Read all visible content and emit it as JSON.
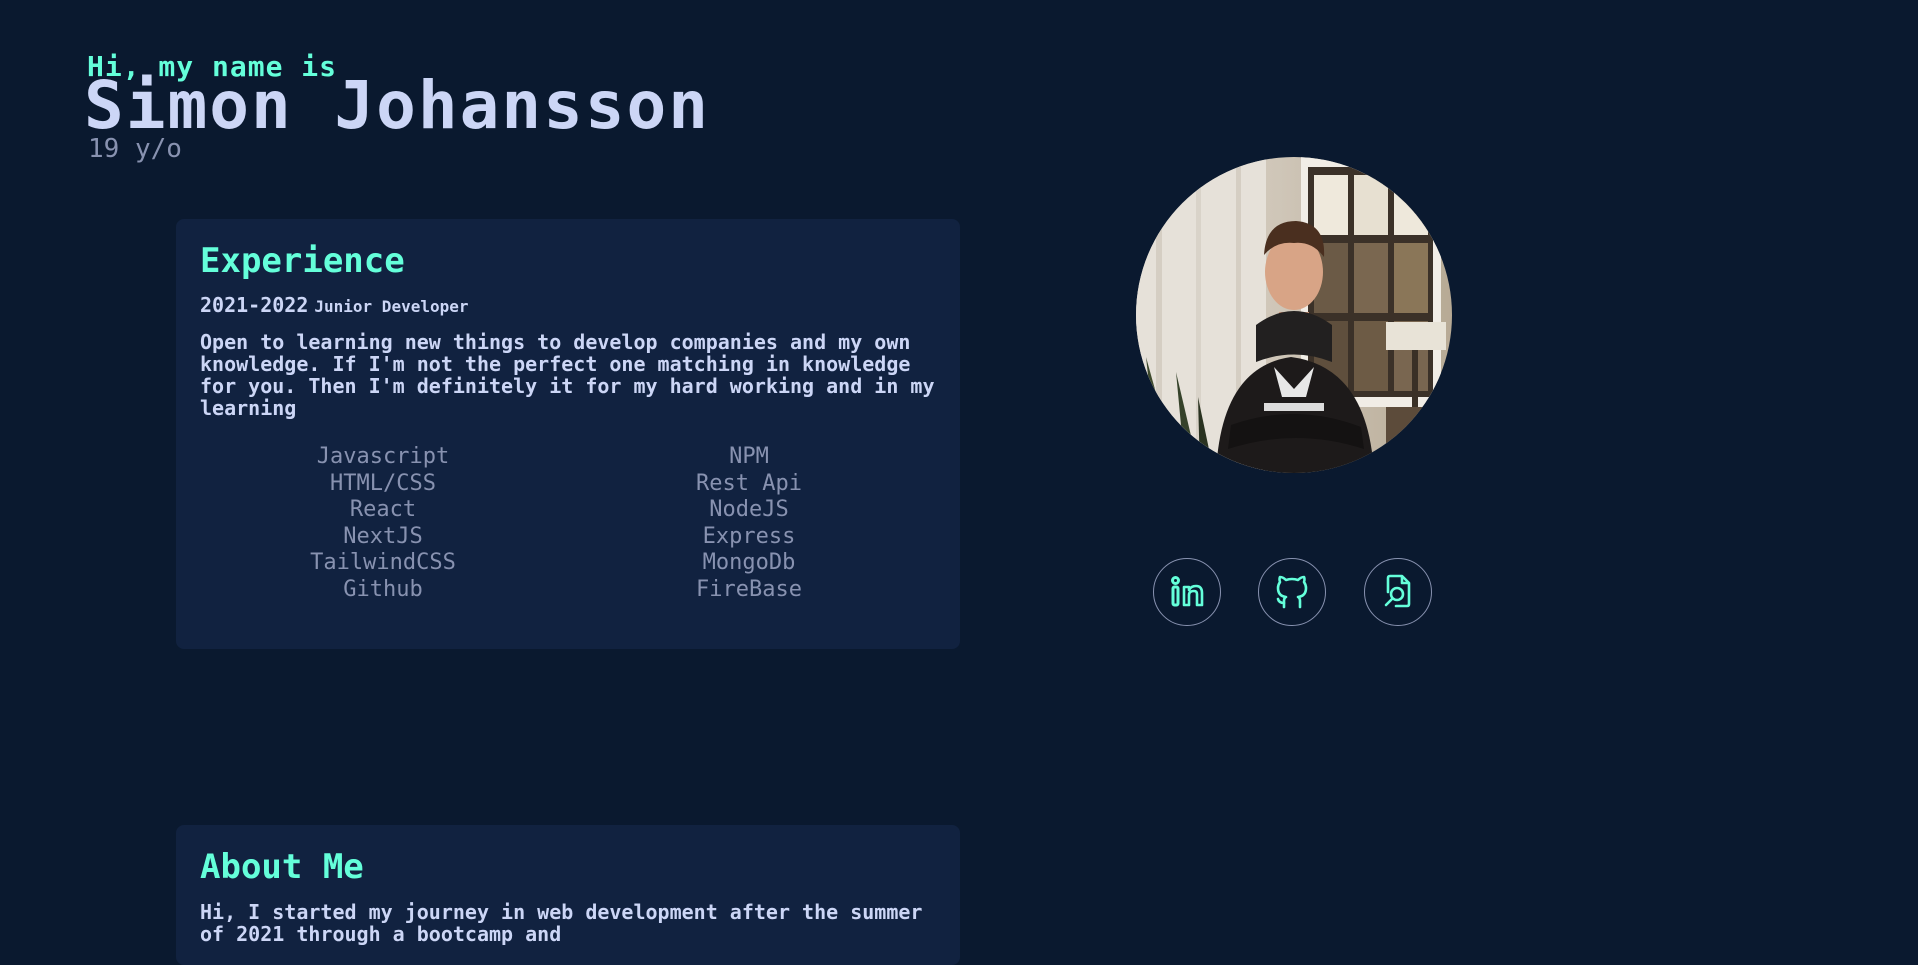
{
  "intro": {
    "greeting": "Hi, my name is",
    "name": "Simon Johansson",
    "age": "19 y/o"
  },
  "experience": {
    "title": "Experience",
    "years": "2021-2022",
    "role": "Junior Developer",
    "description": "Open to learning new things to develop companies and my own knowledge. If I'm not the perfect one matching in knowledge for you. Then I'm definitely it for my hard working and in my learning",
    "skills_left": [
      "Javascript",
      "HTML/CSS",
      "React",
      "NextJS",
      "TailwindCSS",
      "Github"
    ],
    "skills_right": [
      "NPM",
      "Rest Api",
      "NodeJS",
      "Express",
      "MongoDb",
      "FireBase"
    ]
  },
  "about": {
    "title": "About Me",
    "text": "Hi, I started my journey in web development after the summer of 2021 through a bootcamp and"
  },
  "social": {
    "icons": [
      "linkedin-icon",
      "github-icon",
      "resume-icon"
    ]
  },
  "colors": {
    "background": "#0a192f",
    "card": "#112240",
    "accent": "#64ffda",
    "heading": "#ccd6f6",
    "muted": "#8892b0"
  }
}
